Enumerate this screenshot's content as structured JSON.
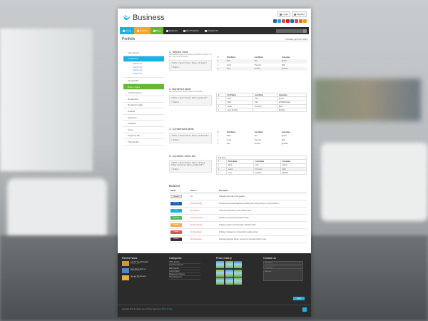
{
  "brand": {
    "name": "Business",
    "accent": "#1ab1e6"
  },
  "header": {
    "login": "Login",
    "register": "Register"
  },
  "socials": [
    "#3b5998",
    "#1da1f2",
    "#dd4b39",
    "#cb2027",
    "#0e76a8",
    "#e4405f",
    "#ff6600",
    "#f39c12"
  ],
  "nav": [
    {
      "label": "Home",
      "color": "#1ab1e6"
    },
    {
      "label": "Portfolio",
      "color": "#f5a623"
    },
    {
      "label": "Blog",
      "color": "#66b832"
    },
    {
      "label": "Features",
      "color": "#2d2d2d"
    },
    {
      "label": "Our Products",
      "color": "#2d2d2d"
    },
    {
      "label": "Contact Us",
      "color": "#2d2d2d"
    }
  ],
  "page": {
    "title": "Portfolio",
    "date": "Tuesday, April 16, 2013"
  },
  "sidebar": {
    "items": [
      {
        "label": "Tree Layout",
        "state": ""
      },
      {
        "label": "Containers",
        "state": "blue"
      },
      {
        "label": "Typography",
        "state": ""
      },
      {
        "label": "Button styles",
        "state": "green"
      },
      {
        "label": "Content layout",
        "state": ""
      },
      {
        "label": "Dropdowns",
        "state": ""
      },
      {
        "label": "Dropdown table",
        "state": ""
      },
      {
        "label": "Tooltips",
        "state": ""
      },
      {
        "label": "Popovers",
        "state": ""
      },
      {
        "label": "Collapse",
        "state": ""
      },
      {
        "label": "Icons",
        "state": ""
      },
      {
        "label": "Progress bar",
        "state": ""
      },
      {
        "label": "Thumbnails",
        "state": ""
      }
    ],
    "subitems": [
      "Subitem 01",
      "Subitem 02",
      "Subitem 03",
      "Subitem 04"
    ]
  },
  "sections": [
    {
      "title": "2. Striped rows",
      "desc": "Adds zebra-striping to any table row within the <tbody> via the :nth-child CSS selector.",
      "code": [
        "<table class=\"table table-striped\">",
        "...",
        "</table>"
      ]
    },
    {
      "title": "3. Bordered table",
      "desc": "Add borders and rounded corners to the table.",
      "code": [
        "<table class=\"table table-bordered\">",
        "...",
        "</table>"
      ]
    },
    {
      "title": "4. Condensed table",
      "desc": "",
      "code": [
        "<table class=\"table table-condensed\">",
        "...",
        "</table>"
      ]
    },
    {
      "title": "5. Combine them all!",
      "desc": "",
      "code": [
        "<table class=\"table table-striped table-bordered table-condensed\">",
        "...",
        "</table>"
      ]
    }
  ],
  "table": {
    "headers": [
      "#",
      "First Name",
      "Last Name",
      "Username"
    ],
    "rows": [
      [
        "1",
        "Mark",
        "Otto",
        "@mdo"
      ],
      [
        "2",
        "Jacob",
        "Thornton",
        "@fat"
      ],
      [
        "3",
        "Larry",
        "the Bird",
        "@twitter"
      ]
    ],
    "rows4": [
      [
        "1",
        "Mark",
        "Otto",
        "@mdo"
      ],
      [
        "",
        "Mark",
        "Otto",
        "@TwBootstrap"
      ],
      [
        "2",
        "Jacob",
        "Thornton",
        "@fat"
      ],
      [
        "3",
        "Larry the Bird",
        "",
        "@twitter"
      ]
    ],
    "caption": "Full name"
  },
  "buttons": {
    "title": "Buttons",
    "headers": [
      "Button",
      "class=\"\"",
      "Description"
    ],
    "rows": [
      {
        "label": "Default",
        "color": "#e6e6e6",
        "text": "#333",
        "cls": "btn",
        "desc": "Standard gray button with gradient"
      },
      {
        "label": "Primary",
        "color": "#1a5fb4",
        "text": "#fff",
        "cls": "btn btn-primary",
        "desc": "Provides extra visual weight and identifies the primary action in a set of buttons"
      },
      {
        "label": "Info",
        "color": "#1ab1e6",
        "text": "#fff",
        "cls": "btn btn-info",
        "desc": "Used as an alternative to the default styles"
      },
      {
        "label": "Success",
        "color": "#5cb85c",
        "text": "#fff",
        "cls": "btn btn-success",
        "desc": "Indicates a successful or positive action"
      },
      {
        "label": "Warning",
        "color": "#f0ad4e",
        "text": "#fff",
        "cls": "btn btn-warning",
        "desc": "Indicates caution should be taken with this action"
      },
      {
        "label": "Danger",
        "color": "#d9534f",
        "text": "#fff",
        "cls": "btn btn-danger",
        "desc": "Indicates a dangerous or potentially negative action"
      },
      {
        "label": "Inverse",
        "color": "#333",
        "text": "#fff",
        "cls": "btn btn-inverse",
        "desc": "Alternate dark gray button, not tied to a semantic action or use"
      }
    ]
  },
  "footer": {
    "recent_title": "Recent News",
    "news": [
      {
        "title": "Just for You Information",
        "date": "June 16, 2013",
        "color": "#c79a3d"
      },
      {
        "title": "New article about us",
        "date": "June 22, 2013",
        "color": "#4b89c5"
      },
      {
        "title": "See our the the best",
        "date": "June 22, 2013",
        "color": "#e0b040"
      }
    ],
    "categories_title": "Categories",
    "categories": [
      "HTML Design",
      "Logo Development",
      "Web Graphic",
      "Custom Work",
      "Manage & Configure",
      "Hosting Services"
    ],
    "gallery_title": "Photo Gallery",
    "gallery_colors": [
      "#5a9fd4",
      "#7fb24a",
      "#3f7fb8",
      "#8fbf4c",
      "#4aa0d8",
      "#6aa83a",
      "#5c9e3a",
      "#3e88c8",
      "#7ab446"
    ],
    "contact_title": "Contact Us",
    "contact": {
      "name": "Your Name",
      "email": "Your Email",
      "message": "Message",
      "send": "Send"
    },
    "copyright": "Copyright 2013 by design.com",
    "privacy": "Privacy Statement",
    "terms": "Terms Of Use"
  }
}
